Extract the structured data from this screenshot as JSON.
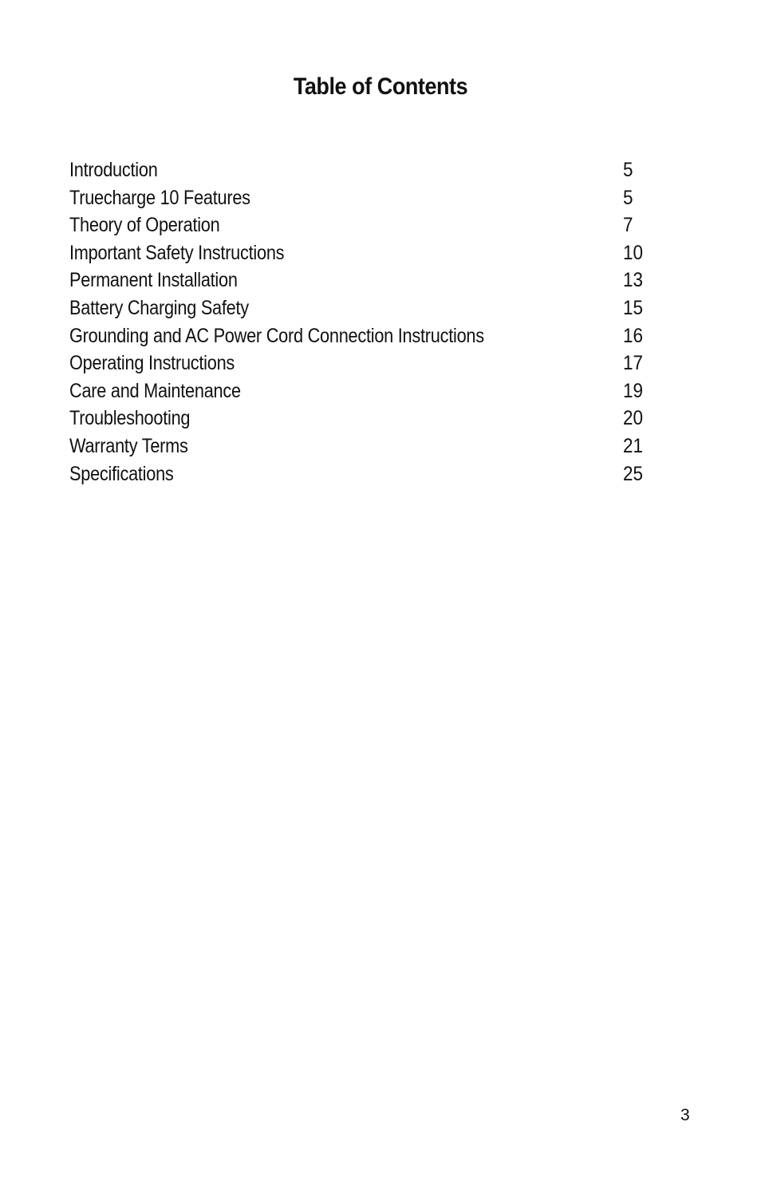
{
  "document": {
    "title": "Table of Contents",
    "entries": [
      {
        "label": "Introduction",
        "page": "5"
      },
      {
        "label": "Truecharge 10 Features",
        "page": "5"
      },
      {
        "label": "Theory of Operation",
        "page": "7"
      },
      {
        "label": "Important Safety Instructions",
        "page": "10"
      },
      {
        "label": "Permanent Installation",
        "page": "13"
      },
      {
        "label": "Battery Charging Safety",
        "page": "15"
      },
      {
        "label": "Grounding and AC Power Cord Connection Instructions",
        "page": "16"
      },
      {
        "label": "Operating Instructions",
        "page": "17"
      },
      {
        "label": "Care and Maintenance",
        "page": "19"
      },
      {
        "label": "Troubleshooting",
        "page": "20"
      },
      {
        "label": "Warranty Terms",
        "page": "21"
      },
      {
        "label": "Specifications",
        "page": "25"
      }
    ],
    "page_number": "3"
  }
}
